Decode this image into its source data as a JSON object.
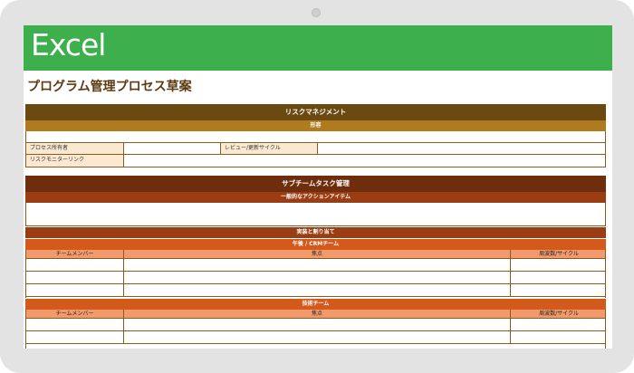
{
  "app": {
    "name": "Excel",
    "accent": "#3daf4d"
  },
  "sheet": {
    "title": "プログラム管理プロセス草案"
  },
  "risk": {
    "header": "リスクマネジメント",
    "sub_header": "形容",
    "fields": [
      {
        "label": "プロセス所有者",
        "value": ""
      },
      {
        "label": "レビュー/更新サイクル",
        "value": ""
      },
      {
        "label": "リスクモニターリンク",
        "value": ""
      }
    ]
  },
  "subteam": {
    "header": "サブチームタスク管理",
    "action_items": "一般的なアクションアイテム",
    "implementation": "実装と割り当て",
    "teams": [
      {
        "name": "午後 / CRMチーム",
        "columns": [
          "チームメンバー",
          "焦点",
          "周波数/サイクル"
        ]
      },
      {
        "name": "技術チーム",
        "columns": [
          "チームメンバー",
          "焦点",
          "周波数/サイクル"
        ]
      }
    ]
  },
  "colors": {
    "risk_header": "#6b4a12",
    "risk_sub": "#b07a1e",
    "subteam_header": "#6e2e0e",
    "subteam_sub": "#9a3d12",
    "team_bar": "#d45a1c",
    "col_header": "#f29a6c",
    "label_fill": "#fbe8d0"
  }
}
